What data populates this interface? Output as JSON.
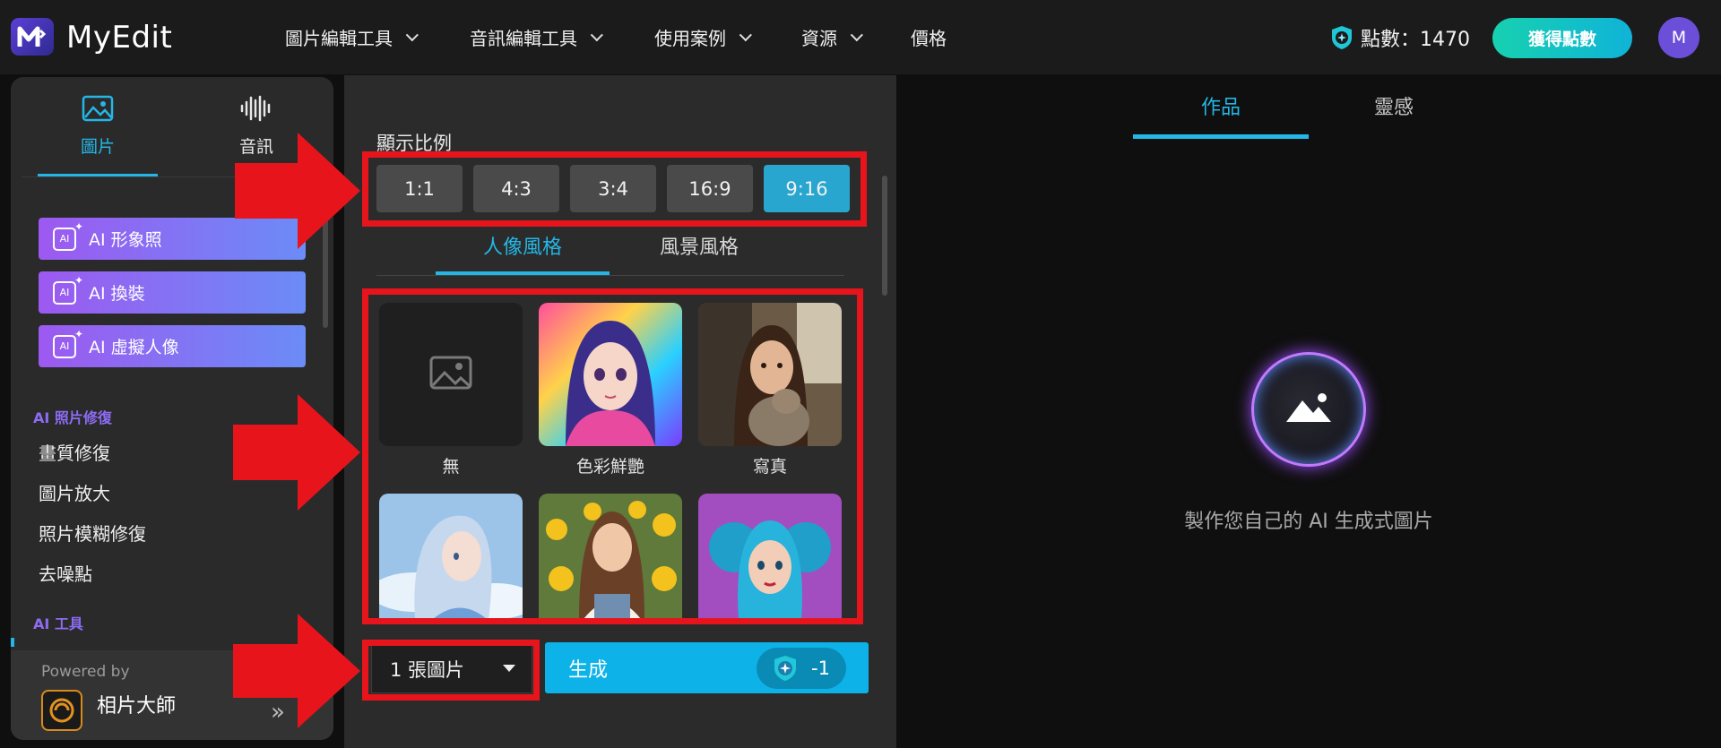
{
  "header": {
    "logo_text": "MyEdit",
    "nav": [
      {
        "label": "圖片編輯工具"
      },
      {
        "label": "音訊編輯工具"
      },
      {
        "label": "使用案例"
      },
      {
        "label": "資源"
      },
      {
        "label": "價格"
      }
    ],
    "points_text": "點數：1470",
    "get_points_label": "獲得點數",
    "avatar_letter": "M"
  },
  "sidebar": {
    "tabs": [
      {
        "label": "圖片",
        "icon": "image-icon"
      },
      {
        "label": "音訊",
        "icon": "waveform-icon"
      }
    ],
    "ai_buttons": [
      {
        "label": "AI 形象照"
      },
      {
        "label": "AI 換裝"
      },
      {
        "label": "AI 虛擬人像"
      }
    ],
    "section_photo_fix": "AI 照片修復",
    "photo_fix_items": [
      "畫質修復",
      "圖片放大",
      "照片模糊修復",
      "去噪點"
    ],
    "section_ai_tools": "AI 工具",
    "powered_by": "Powered by",
    "powered_name": "相片大師"
  },
  "generator": {
    "ratio_title": "顯示比例",
    "ratios": [
      "1:1",
      "4:3",
      "3:4",
      "16:9",
      "9:16"
    ],
    "active_ratio": "9:16",
    "style_tabs": [
      "人像風格",
      "風景風格"
    ],
    "styles": [
      {
        "label": "無"
      },
      {
        "label": "色彩鮮艷"
      },
      {
        "label": "寫真"
      },
      {
        "label": ""
      },
      {
        "label": ""
      },
      {
        "label": ""
      }
    ],
    "count_value": "1 張圖片",
    "generate_label": "生成",
    "generate_cost": "-1"
  },
  "results": {
    "tabs": [
      "作品",
      "靈感"
    ],
    "empty_text": "製作您自己的 AI 生成式圖片"
  },
  "colors": {
    "accent": "#24b6e6",
    "annotation_red": "#e8141c",
    "active_ratio_bg": "#28a6cf"
  }
}
